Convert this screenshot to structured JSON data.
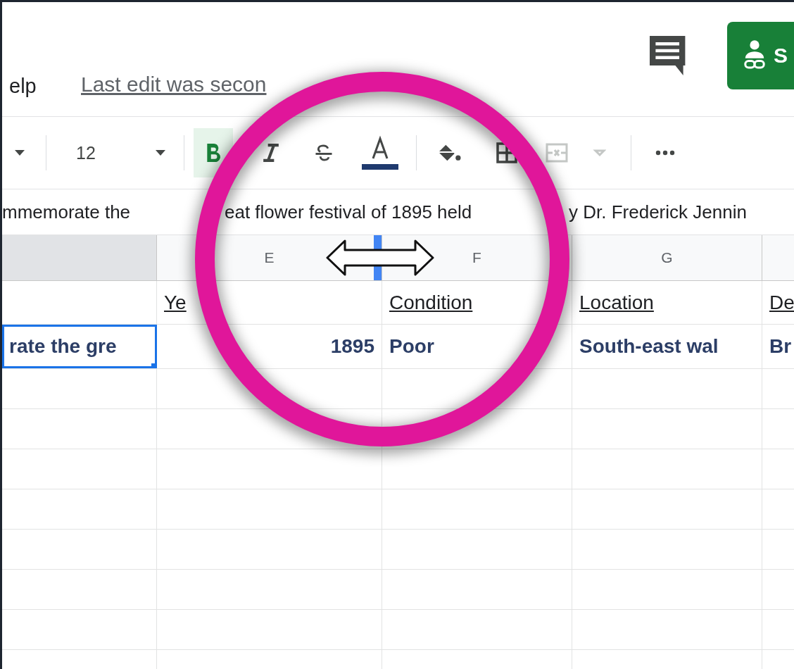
{
  "menu": {
    "label": "elp"
  },
  "last_edit": "Last edit was secon",
  "share_button": {
    "label": "S"
  },
  "toolbar": {
    "font_size": "12",
    "bold_active": true,
    "merge_disabled": true
  },
  "formula_bar": {
    "segments": [
      "mmemorate the",
      "eat flower festival of 1895 held",
      "y Dr. Frederick Jennin"
    ]
  },
  "columns": [
    {
      "selected": true
    },
    {
      "label": "E",
      "selected": false
    },
    {
      "label": "F",
      "selected": false
    },
    {
      "label": "G",
      "selected": false
    }
  ],
  "rows": [
    {
      "kind": "header",
      "cells": [
        {},
        {
          "text": "Ye"
        },
        {
          "text": "Condition"
        },
        {
          "text": "Location"
        },
        {
          "text": "De"
        }
      ]
    },
    {
      "kind": "data",
      "cells": [
        {
          "text": "rate the gre",
          "selected": true
        },
        {
          "text": "1895",
          "kind": "number"
        },
        {
          "text": "Poor"
        },
        {
          "text": "South-east wal"
        },
        {
          "text": "Br"
        }
      ]
    }
  ]
}
